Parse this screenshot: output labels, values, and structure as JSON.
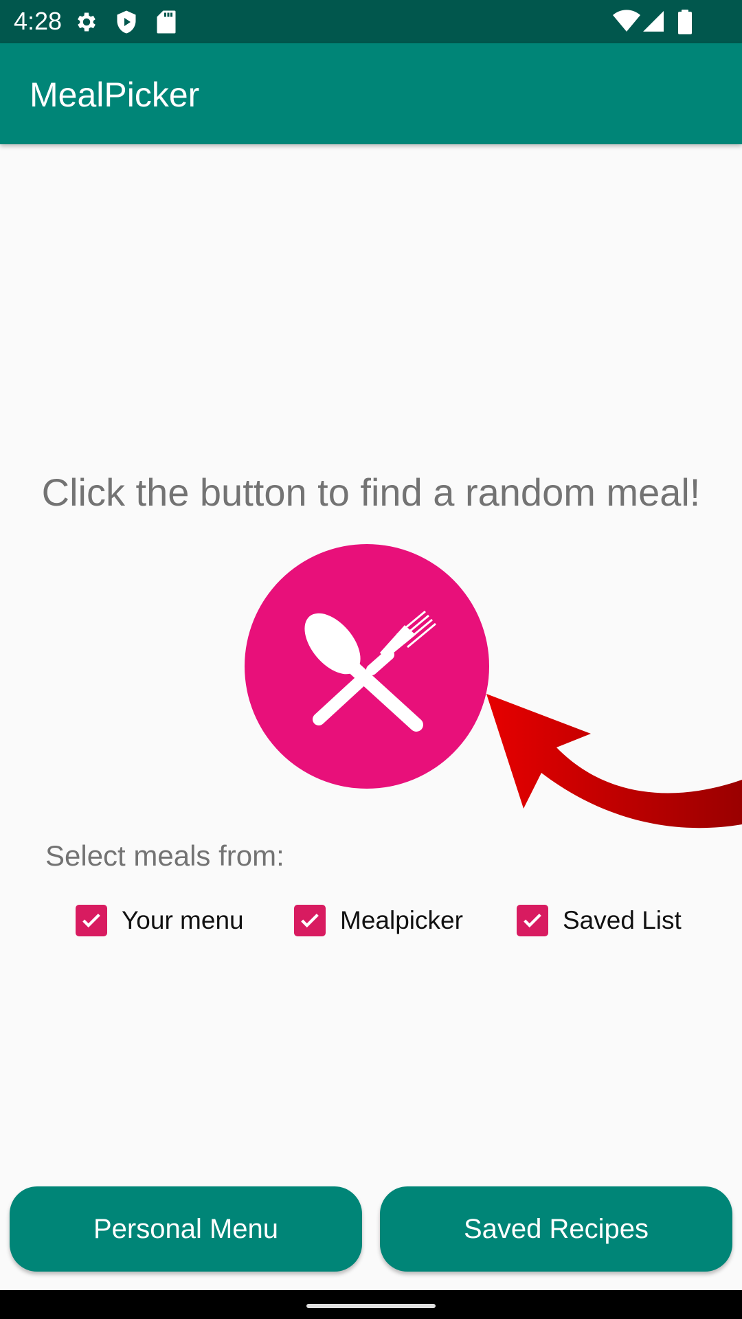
{
  "status_bar": {
    "time": "4:28",
    "left_icons": [
      "gear-icon",
      "shield-play-icon",
      "sd-card-icon"
    ],
    "right_icons": [
      "wifi-icon",
      "signal-icon",
      "battery-icon"
    ]
  },
  "app_bar": {
    "title": "MealPicker"
  },
  "main": {
    "prompt": "Click the button to find a random meal!",
    "meal_button_icon": "fork-spoon-icon",
    "select_label": "Select meals from:",
    "sources": [
      {
        "label": "Your menu",
        "checked": true
      },
      {
        "label": "Mealpicker",
        "checked": true
      },
      {
        "label": "Saved List",
        "checked": true
      }
    ]
  },
  "buttons": {
    "personal_menu": "Personal Menu",
    "saved_recipes": "Saved Recipes"
  },
  "colors": {
    "status_bar": "#01574d",
    "primary": "#008577",
    "accent": "#d81b60",
    "meal_button": "#e8107a",
    "arrow": "#e00000"
  }
}
